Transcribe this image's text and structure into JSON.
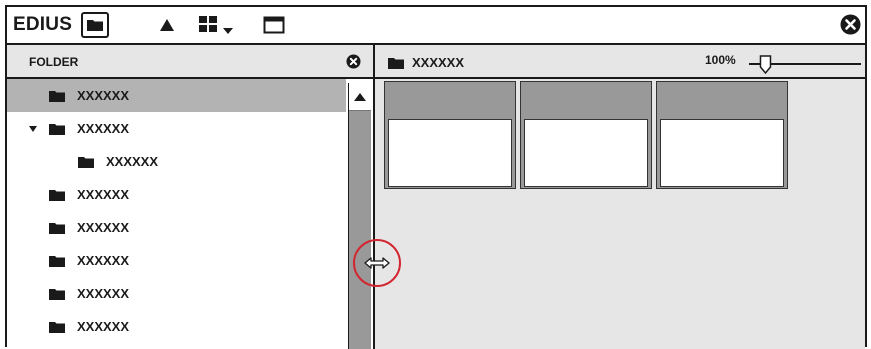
{
  "app": {
    "title": "EDIUS"
  },
  "toolbar": {
    "folder_icon": "folder-icon",
    "up_icon": "up-arrow-icon",
    "thumbnail_view_icon": "thumbnail-view-dropdown-icon",
    "window_icon": "window-icon",
    "close_icon": "close-icon"
  },
  "folder_panel": {
    "title": "FOLDER",
    "items": [
      {
        "label": "XXXXXX",
        "selected": true,
        "expanded": false,
        "indent": 0
      },
      {
        "label": "XXXXXX",
        "selected": false,
        "expanded": true,
        "indent": 0
      },
      {
        "label": "XXXXXX",
        "selected": false,
        "expanded": false,
        "indent": 1
      },
      {
        "label": "XXXXXX",
        "selected": false,
        "expanded": false,
        "indent": 0
      },
      {
        "label": "XXXXXX",
        "selected": false,
        "expanded": false,
        "indent": 0
      },
      {
        "label": "XXXXXX",
        "selected": false,
        "expanded": false,
        "indent": 0
      },
      {
        "label": "XXXXXX",
        "selected": false,
        "expanded": false,
        "indent": 0
      },
      {
        "label": "XXXXXX",
        "selected": false,
        "expanded": false,
        "indent": 0
      }
    ]
  },
  "clip_panel": {
    "folder_label": "XXXXXX",
    "zoom": "100%",
    "zoom_level": 0.12,
    "thumbnail_count": 3
  },
  "colors": {
    "selection": "#b3b3b3",
    "panel_bg": "#e6e6e6",
    "scrollbar": "#999999",
    "highlight_ring": "#d22630"
  }
}
